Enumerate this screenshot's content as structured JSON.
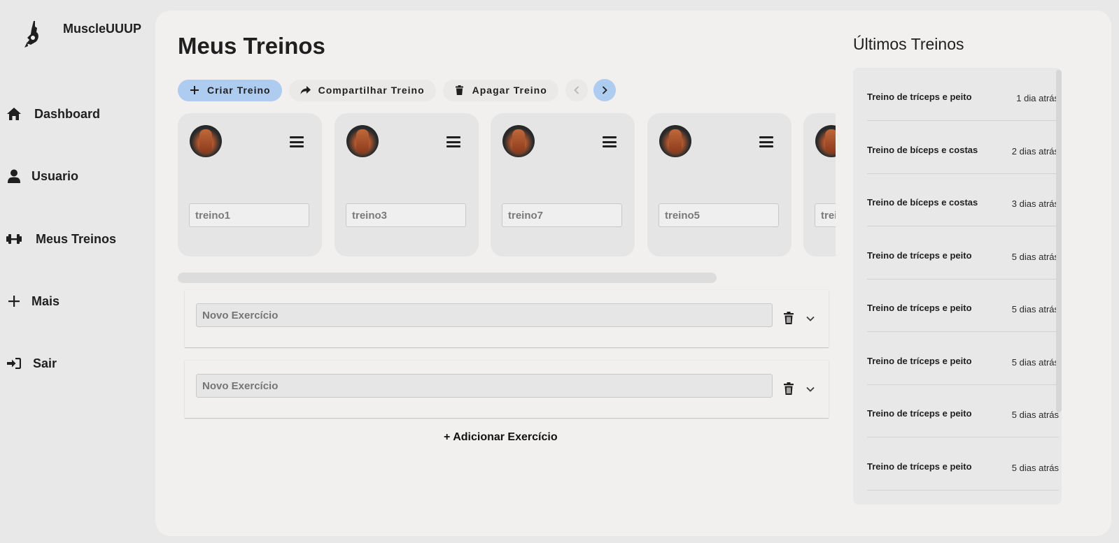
{
  "brand": {
    "name": "MuscleUUUP"
  },
  "sidebar": {
    "items": [
      {
        "label": "Dashboard",
        "icon": "home-icon"
      },
      {
        "label": "Usuario",
        "icon": "user-icon"
      },
      {
        "label": "Meus Treinos",
        "icon": "dumbbell-icon"
      },
      {
        "label": "Mais",
        "icon": "plus-icon"
      },
      {
        "label": "Sair",
        "icon": "sign-in-icon"
      }
    ]
  },
  "main": {
    "title": "Meus Treinos",
    "toolbar": {
      "create_label": "Criar Treino",
      "share_label": "Compartilhar Treino",
      "delete_label": "Apagar Treino"
    },
    "workouts": [
      {
        "name": "treino1"
      },
      {
        "name": "treino3"
      },
      {
        "name": "treino7"
      },
      {
        "name": "treino5"
      },
      {
        "name": "trei"
      }
    ],
    "exercise_placeholder": "Novo Exercício",
    "exercises": [
      {
        "value": ""
      },
      {
        "value": ""
      }
    ],
    "add_exercise_label": "+ Adicionar Exercício"
  },
  "recent": {
    "title": "Últimos Treinos",
    "items": [
      {
        "name": "Treino de tríceps e peito",
        "time": "1 dia atrás"
      },
      {
        "name": "Treino de bíceps e costas",
        "time": "2 dias atrás"
      },
      {
        "name": "Treino de bíceps e costas",
        "time": "3 dias atrás"
      },
      {
        "name": "Treino de tríceps e peito",
        "time": "5 dias atrás"
      },
      {
        "name": "Treino de tríceps e peito",
        "time": "5 dias atrás"
      },
      {
        "name": "Treino de tríceps e peito",
        "time": "5 dias atrás"
      },
      {
        "name": "Treino de tríceps e peito",
        "time": "5 dias atrás"
      },
      {
        "name": "Treino de tríceps e peito",
        "time": "5 dias atrás"
      }
    ]
  },
  "colors": {
    "accent": "#aecbf0",
    "panel": "#f2efef",
    "background": "#e8e8e8"
  }
}
